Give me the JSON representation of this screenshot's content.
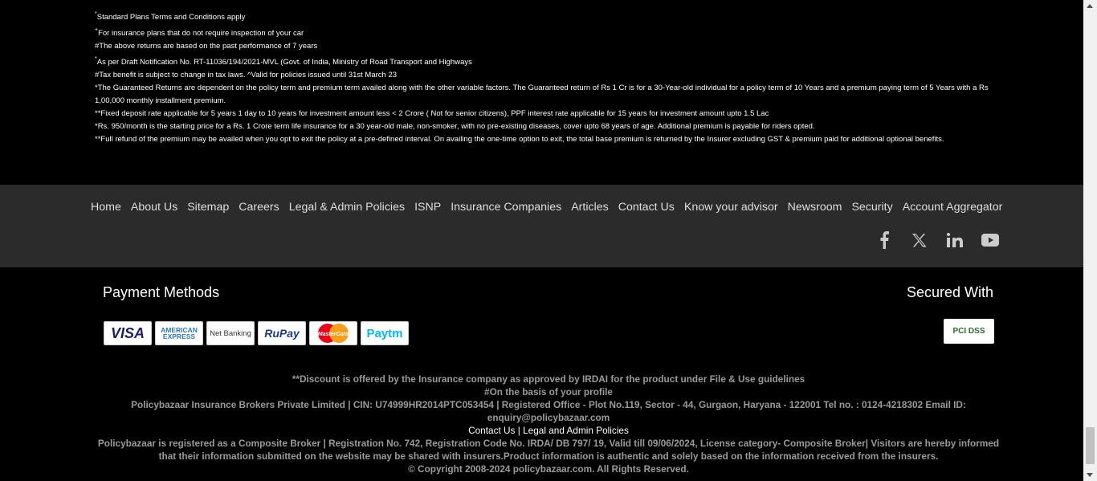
{
  "disclaimers": [
    {
      "mark": "*",
      "text": "Standard Plans Terms and Conditions apply"
    },
    {
      "mark": "+",
      "text": "For insurance plans that do not require inspection of your car"
    },
    {
      "mark": "",
      "text": "#The above returns are based on the past performance of 7 years"
    },
    {
      "mark": "*",
      "text": "As per Draft Notification No. RT-11036/194/2021-MVL (Govt. of India, Ministry of Road Transport and Highways"
    },
    {
      "mark": "",
      "text": "#Tax benefit is subject to change in tax laws. ^Valid for policies issued until 31st March 23"
    },
    {
      "mark": "",
      "text": "*The Guaranteed Returns are dependent on the policy term and premium term availed along with the other variable factors. The Guaranteed return of Rs 1 Cr is for a 30-Year-old individual for a policy term of 10 Years and a premium paying term of 5 Years with a Rs 1,00,000 monthly installment premium."
    },
    {
      "mark": "",
      "text": "**Fixed deposit rate applicable for 5 years 1 day to 10 years for investment amount less < 2 Crore ( Not for senior citizens), PPF interest rate applicable for 15 years for investment amount upto 1.5 Lac"
    },
    {
      "mark": "",
      "text": "*Rs. 950/month is the starting price for a Rs. 1 Crore term life insurance for a 30 year-old male, non-smoker, with no pre-existing diseases, cover upto 68 years of age. Additional premium is payable for riders opted."
    },
    {
      "mark": "",
      "text": "**Full refund of the premium may be availed when you opt to exit the policy at a pre-defined interval. On availing the one-time option to exit, the total base premium is returned by the Insurer excluding GST & premium paid for additional optional benefits."
    }
  ],
  "footer_links": [
    "Home",
    "About Us",
    "Sitemap",
    "Careers",
    "Legal & Admin Policies",
    "ISNP",
    "Insurance Companies",
    "Articles",
    "Contact Us",
    "Know your advisor",
    "Newsroom",
    "Security",
    "Account Aggregator"
  ],
  "social": [
    "facebook-icon",
    "x-icon",
    "linkedin-icon",
    "youtube-icon"
  ],
  "payments": {
    "title": "Payment Methods",
    "secured_title": "Secured With",
    "logos": [
      "VISA",
      "AMERICAN EXPRESS",
      "Net Banking",
      "RuPay",
      "MasterCard",
      "Paytm"
    ],
    "pci_label": "PCI DSS"
  },
  "bottom": {
    "line1": "**Discount is offered by the Insurance company as approved by IRDAI for the product under File & Use guidelines",
    "line2": "#On the basis of your profile",
    "line3": "Policybazaar Insurance Brokers Private Limited | CIN: U74999HR2014PTC053454 | Registered Office - Plot No.119, Sector - 44, Gurgaon, Haryana - 122001 Tel no. : 0124-4218302 Email ID: enquiry@policybazaar.com",
    "contact_link": "Contact Us",
    "sep": " | ",
    "legal_link": "Legal and Admin Policies",
    "line5": "Policybazaar is registered as a Composite Broker | Registration No. 742, Registration Code No. IRDA/ DB 797/ 19, Valid till 09/06/2024, License category- Composite Broker| Visitors are hereby informed that their information submitted on the website may be shared with insurers.Product information is authentic and solely based on the information received from the insurers.",
    "copyright": "© Copyright 2008-2024 policybazaar.com. All Rights Reserved."
  }
}
